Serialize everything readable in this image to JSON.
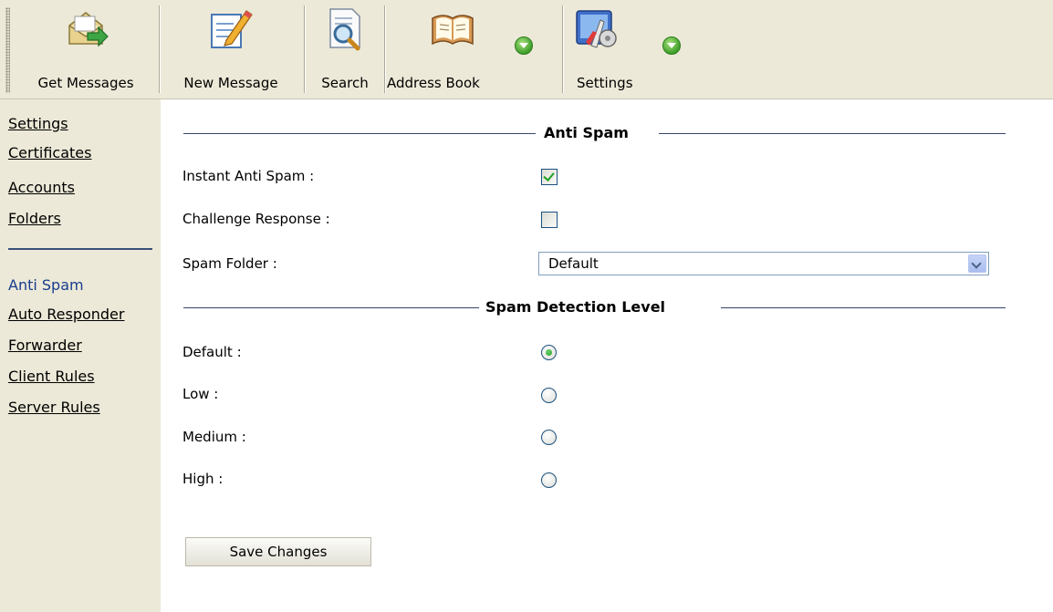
{
  "toolbar": {
    "get_messages": "Get Messages",
    "new_message": "New Message",
    "search": "Search",
    "address_book": "Address Book",
    "settings": "Settings"
  },
  "sidebar": {
    "items": [
      {
        "label": "Settings"
      },
      {
        "label": "Certificates"
      },
      {
        "label": "Accounts"
      },
      {
        "label": "Folders"
      },
      {
        "label": "Anti Spam",
        "active": true
      },
      {
        "label": "Auto Responder"
      },
      {
        "label": "Forwarder"
      },
      {
        "label": "Client Rules"
      },
      {
        "label": "Server Rules"
      }
    ]
  },
  "anti_spam": {
    "title": "Anti Spam",
    "instant_label": "Instant Anti Spam :",
    "instant_checked": true,
    "challenge_label": "Challenge Response :",
    "challenge_checked": false,
    "folder_label": "Spam Folder :",
    "folder_value": "Default"
  },
  "detection": {
    "title": "Spam Detection Level",
    "levels": [
      {
        "label": "Default :",
        "selected": true
      },
      {
        "label": "Low :",
        "selected": false
      },
      {
        "label": "Medium :",
        "selected": false
      },
      {
        "label": "High :",
        "selected": false
      }
    ]
  },
  "save_label": "Save Changes",
  "colors": {
    "toolbar_bg": "#ece9d8",
    "section_line": "#35456b",
    "active_link": "#1a3d8f",
    "check_green": "#21a121"
  }
}
